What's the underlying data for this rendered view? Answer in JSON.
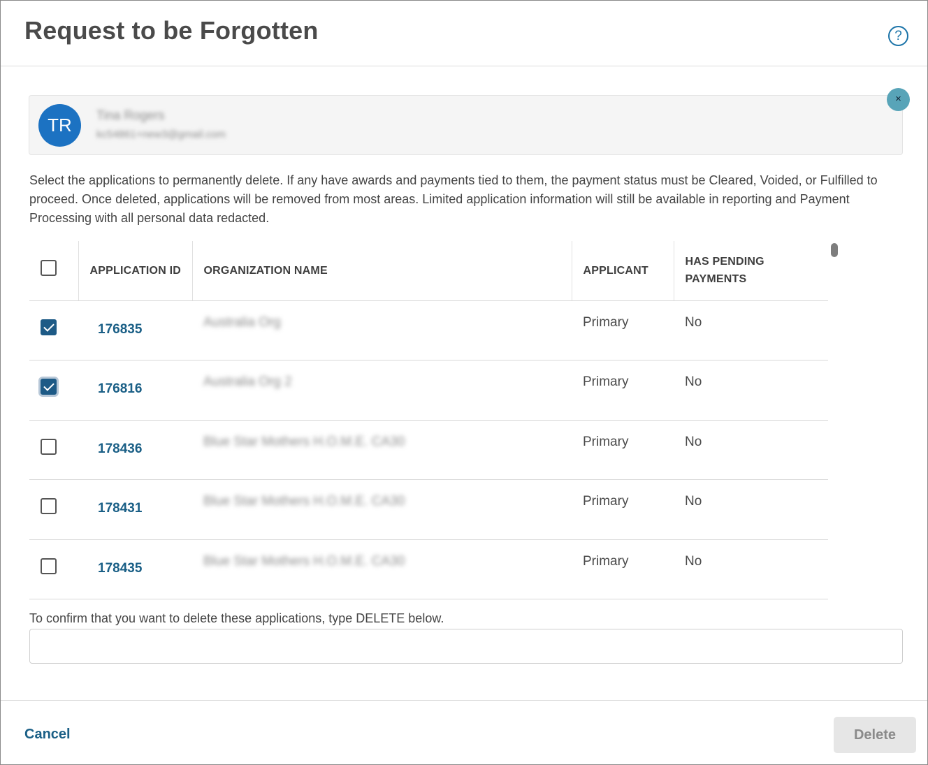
{
  "header": {
    "title": "Request to be Forgotten",
    "help_icon": "help-circle-icon",
    "help_glyph": "?"
  },
  "user": {
    "initials": "TR",
    "name": "Tina Rogers",
    "email": "kc54861+new3@gmail.com",
    "avatar_color": "#1c72c2",
    "close_glyph": "×"
  },
  "description": "Select the applications to permanently delete. If any have awards and payments tied to them, the payment status must be Cleared, Voided, or Fulfilled to proceed. Once deleted, applications will be removed from most areas. Limited application information will still be available in reporting and Payment Processing with all personal data redacted.",
  "table": {
    "columns": [
      "Application ID",
      "Organization Name",
      "Applicant",
      "Has Pending Payments"
    ],
    "rows": [
      {
        "checked": true,
        "app_id": "176835",
        "org": "Australia Org",
        "applicant": "Primary",
        "pending": "No"
      },
      {
        "checked": true,
        "app_id": "176816",
        "org": "Australia Org 2",
        "applicant": "Primary",
        "pending": "No"
      },
      {
        "checked": false,
        "app_id": "178436",
        "org": "Blue Star Mothers H.O.M.E. CA30",
        "applicant": "Primary",
        "pending": "No"
      },
      {
        "checked": false,
        "app_id": "178431",
        "org": "Blue Star Mothers H.O.M.E. CA30",
        "applicant": "Primary",
        "pending": "No"
      },
      {
        "checked": false,
        "app_id": "178435",
        "org": "Blue Star Mothers H.O.M.E. CA30",
        "applicant": "Primary",
        "pending": "No"
      }
    ]
  },
  "confirm": {
    "label": "To confirm that you want to delete these applications, type DELETE below.",
    "value": "",
    "placeholder": ""
  },
  "footer": {
    "cancel_label": "Cancel",
    "delete_label": "Delete"
  },
  "colors": {
    "accent": "#1a5f86",
    "checkbox_checked": "#1d5a86",
    "close_button": "#58a4b8",
    "delete_disabled_bg": "#e6e6e6"
  }
}
